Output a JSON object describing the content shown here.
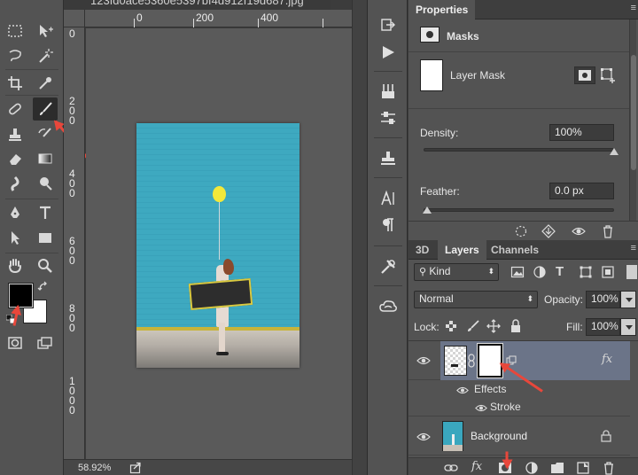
{
  "document": {
    "title": "123fd0ace5360e5397bf4d912f19d687.jpg",
    "zoom": "58.92%"
  },
  "rulers": {
    "top": [
      "0",
      "200",
      "400"
    ],
    "left": [
      "0",
      "2\n0\n0",
      "4\n0\n0",
      "6\n0\n0",
      "8\n0\n0",
      "1\n0\n0\n0"
    ]
  },
  "properties": {
    "tab": "Properties",
    "section": "Masks",
    "mask_label": "Layer Mask",
    "density_label": "Density:",
    "density_value": "100%",
    "density_level": 1.0,
    "feather_label": "Feather:",
    "feather_value": "0.0 px",
    "feather_level": 0.0
  },
  "layers_panel": {
    "tabs": [
      "3D",
      "Layers",
      "Channels"
    ],
    "active_tab": "Layers",
    "filter_kind": "Kind",
    "blend_mode": "Normal",
    "opacity_label": "Opacity:",
    "opacity_value": "100%",
    "lock_label": "Lock:",
    "fill_label": "Fill:",
    "fill_value": "100%",
    "layers": [
      {
        "name": "",
        "effects_label": "Effects",
        "stroke_label": "Stroke",
        "fx": "fx"
      },
      {
        "name": "Background"
      }
    ]
  },
  "colors": {
    "accent_arrow": "#e8473b",
    "foreground_swatch": "#000000",
    "background_swatch": "#ffffff",
    "photo_wall": "#3aa7be",
    "selected_layer": "#6b7488"
  },
  "icons": {
    "tools": [
      "marquee-icon",
      "move-icon",
      "lasso-icon",
      "magic-wand-icon",
      "crop-icon",
      "eyedropper-icon",
      "healing-brush-icon",
      "brush-icon",
      "clone-stamp-icon",
      "history-brush-icon",
      "eraser-icon",
      "gradient-icon",
      "blur-icon",
      "dodge-icon",
      "pen-icon",
      "type-icon",
      "path-selection-icon",
      "rectangle-icon",
      "hand-icon",
      "zoom-icon",
      "quick-mask-icon",
      "screen-mode-icon"
    ],
    "dock": [
      "history-icon",
      "actions-icon",
      "brushes-icon",
      "adjustments-icon",
      "clone-source-icon",
      "character-icon",
      "paragraph-icon",
      "tool-presets-icon",
      "libraries-icon"
    ]
  }
}
